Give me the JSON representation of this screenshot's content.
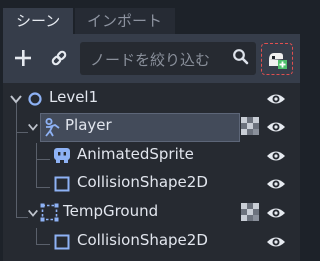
{
  "tabs": [
    {
      "label": "シーン",
      "active": true
    },
    {
      "label": "インポート",
      "active": false
    }
  ],
  "toolbar": {
    "add_icon": "plus-icon",
    "link_icon": "link-icon",
    "filter_placeholder": "ノードを絞り込む",
    "search_icon": "search-icon",
    "instance_icon": "instance-scene-icon"
  },
  "tree": {
    "nodes": [
      {
        "label": "Level1",
        "icon": "node2d-circle-icon",
        "expanded": true,
        "depth": 0,
        "visible": true
      },
      {
        "label": "Player",
        "icon": "kinematic-body-icon",
        "expanded": true,
        "depth": 1,
        "visible": true,
        "selected": true,
        "scene_icon": true
      },
      {
        "label": "AnimatedSprite",
        "icon": "animated-sprite-icon",
        "depth": 2,
        "visible": true
      },
      {
        "label": "CollisionShape2D",
        "icon": "collision-shape-icon",
        "depth": 2,
        "visible": true
      },
      {
        "label": "TempGround",
        "icon": "static-body-icon",
        "expanded": true,
        "depth": 1,
        "visible": true,
        "scene_icon": true
      },
      {
        "label": "CollisionShape2D",
        "icon": "collision-shape-icon",
        "depth": 2,
        "visible": true
      }
    ]
  },
  "colors": {
    "background": "#1d2229",
    "panel": "#363d4a",
    "tree_bg": "#262a31",
    "selected": "#434b5a",
    "accent_blue": "#8eb2f5",
    "warning_red": "#e04f4f"
  }
}
